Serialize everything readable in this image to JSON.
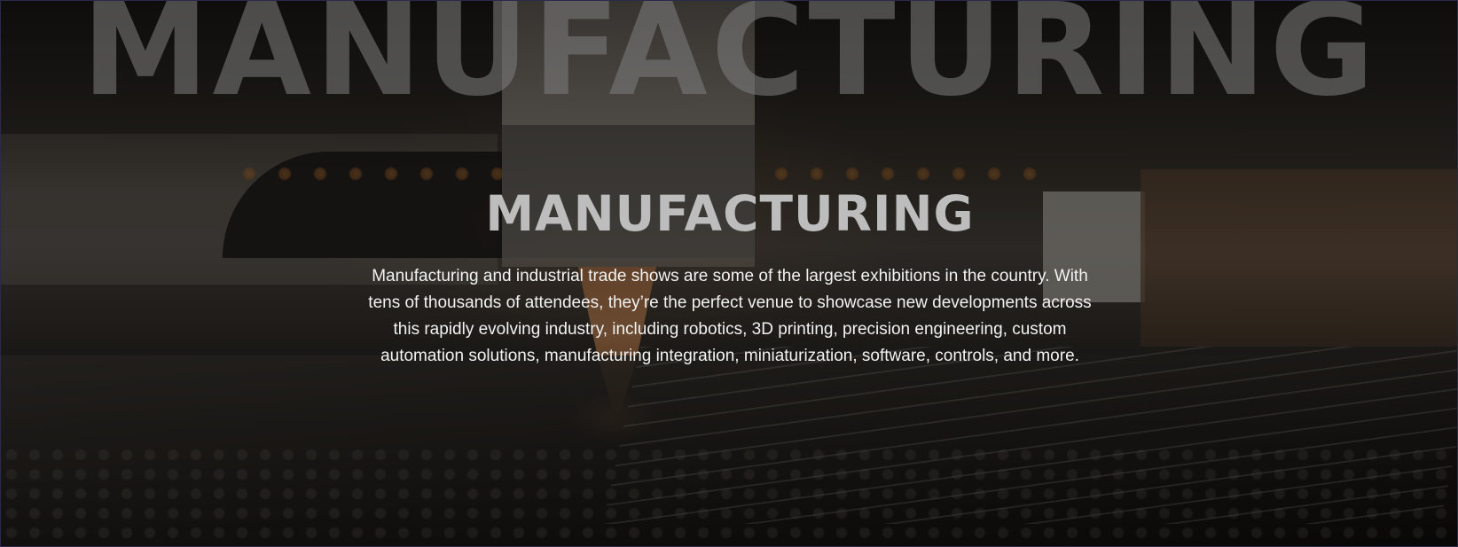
{
  "hero": {
    "watermark": "MANUFACTURING",
    "title": "MANUFACTURING",
    "description": "Manufacturing and industrial trade shows are some of the largest exhibitions in the country. With tens of thousands of attendees, they’re the perfect venue to showcase new developments across this rapidly evolving industry, including robotics, 3D printing, precision engineering, custom automation solutions, manufacturing integration, miniaturization, software, controls, and more.",
    "background_image": "laser-cutting-machine-photo",
    "colors": {
      "title": "#bdbdbd",
      "watermark": "#808080",
      "description": "#f2f2f2",
      "overlay": "#000000"
    }
  }
}
